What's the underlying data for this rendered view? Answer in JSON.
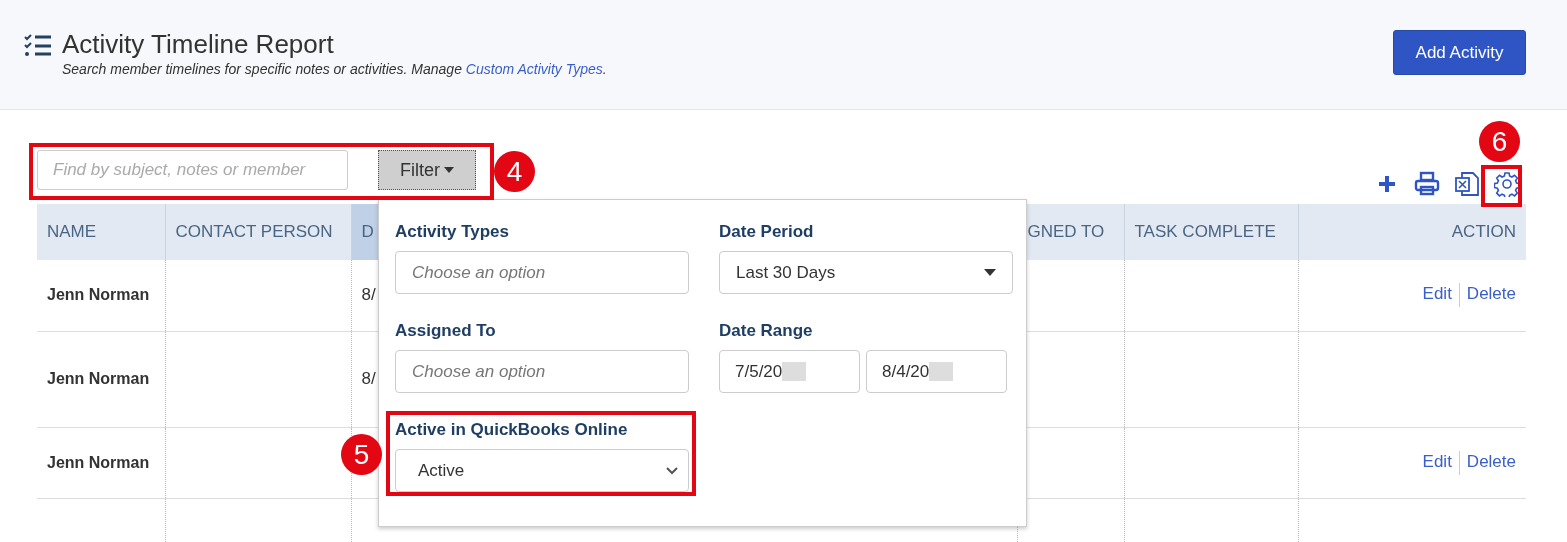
{
  "header": {
    "title": "Activity Timeline Report",
    "subtitle": "Search member timelines for specific notes or activities. Manage ",
    "subtitle_link": "Custom Activity Types",
    "subtitle_end": ".",
    "add_button": "Add Activity"
  },
  "search": {
    "placeholder": "Find by subject, notes or member"
  },
  "filter_button": {
    "label": "Filter",
    "expanded": true
  },
  "toolbar": [
    {
      "kind": "add"
    },
    {
      "kind": "print"
    },
    {
      "kind": "excel"
    },
    {
      "kind": "settings"
    }
  ],
  "table": {
    "columns": [
      {
        "label": "NAME",
        "sorted": false
      },
      {
        "label": "CONTACT PERSON",
        "sorted": false
      },
      {
        "label": "D",
        "sorted": true
      },
      {
        "label": "GNED TO",
        "sorted": false
      },
      {
        "label": "TASK COMPLETE",
        "sorted": false
      },
      {
        "label": "ACTION",
        "sorted": false
      }
    ],
    "rows": [
      {
        "name": "Jenn Norman",
        "date": "8/",
        "actions": [
          "Edit",
          "Delete"
        ]
      },
      {
        "name": "Jenn Norman",
        "date": "8/"
      },
      {
        "name": "Jenn Norman",
        "actions": [
          "Edit",
          "Delete"
        ]
      },
      {}
    ]
  },
  "filter_panel": {
    "fields": [
      {
        "kind": "multi",
        "label": "Activity Types",
        "placeholder": "Choose an option"
      },
      {
        "kind": "select",
        "label": "Date Period",
        "value": "Last 30 Days"
      },
      {
        "kind": "multi",
        "label": "Assigned To",
        "placeholder": "Choose an option"
      },
      {
        "kind": "range",
        "label": "Date Range",
        "values": [
          "7/5/20",
          "8/4/20"
        ],
        "redacted": true
      },
      {
        "kind": "native-select",
        "label": "Active in QuickBooks Online",
        "value": "Active"
      }
    ]
  },
  "annotations": [
    {
      "number": "4"
    },
    {
      "number": "5"
    },
    {
      "number": "6"
    }
  ]
}
